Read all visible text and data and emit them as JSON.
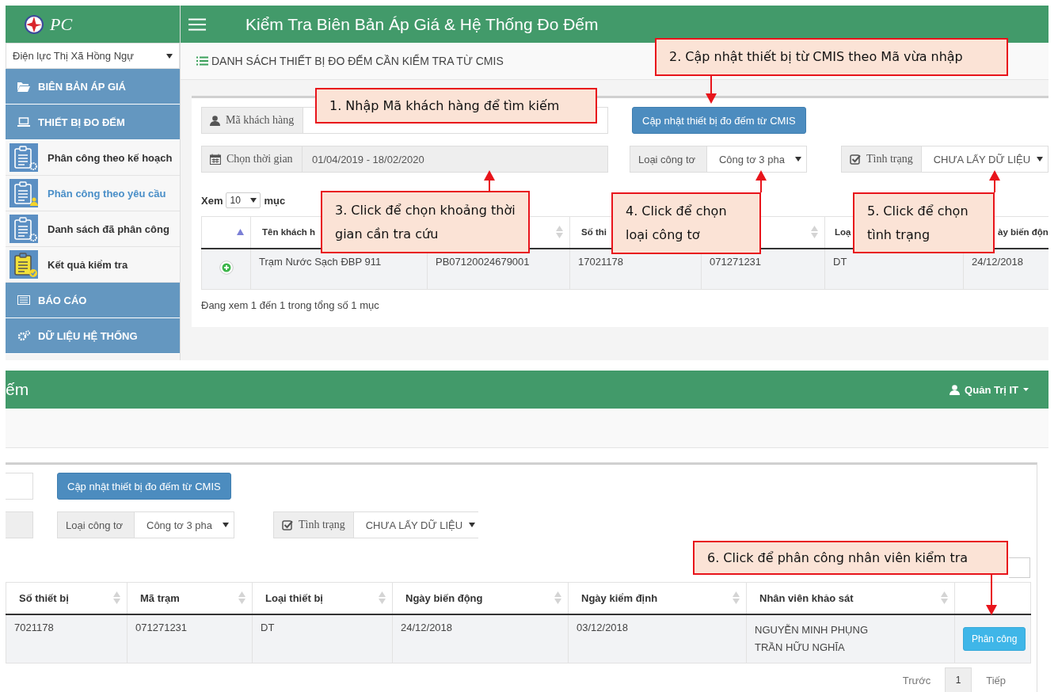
{
  "top_view": {
    "logo": {
      "text": "PC"
    },
    "unit_select": {
      "value": "Điện lực Thị Xã Hồng Ngự"
    },
    "header": {
      "title": "Kiểm Tra Biên Bản Áp Giá & Hệ Thống Đo Đếm"
    },
    "sidebar": {
      "items": [
        {
          "label": "BIÊN BẢN ÁP GIÁ"
        },
        {
          "label": "THIẾT BỊ ĐO ĐẾM",
          "children": [
            {
              "label": "Phân công theo kế hoạch",
              "selected": false
            },
            {
              "label": "Phân công theo yêu cầu",
              "selected": true
            },
            {
              "label": "Danh sách đã phân công",
              "selected": false
            },
            {
              "label": "Kết quả kiểm tra",
              "selected": false
            }
          ]
        },
        {
          "label": "BÁO CÁO"
        },
        {
          "label": "DỮ LIỆU HỆ THỐNG"
        }
      ]
    },
    "page_heading": "DANH SÁCH THIẾT BỊ ĐO ĐẾM CẦN KIỂM TRA TỪ CMIS",
    "customer_code": {
      "label": "Mã khách hàng"
    },
    "update_button": "Cập nhật thiết bị đo đếm từ CMIS",
    "time_range": {
      "label": "Chọn thời gian",
      "value": "01/04/2019 - 18/02/2020"
    },
    "meter_type": {
      "label": "Loại công tơ",
      "value": "Công tơ 3 pha"
    },
    "status": {
      "label": "Tình trạng",
      "value": "CHƯA LẤY DỮ LIỆU"
    },
    "page_size": {
      "prefix": "Xem",
      "value": "10",
      "suffix": "mục"
    },
    "table": {
      "columns": [
        {
          "kind": "expander",
          "sorted": true
        },
        {
          "kind": "text",
          "label": "Tên khách h"
        },
        {
          "kind": "text",
          "sortable": true
        },
        {
          "kind": "text",
          "label": "Số thi"
        },
        {
          "kind": "text",
          "sortable": true
        },
        {
          "kind": "text",
          "label": "Loạ"
        },
        {
          "kind": "text",
          "label": "ày biến độn"
        }
      ],
      "rows": [
        {
          "cells": [
            "",
            "Trạm Nước Sạch ĐBP 911",
            "PB07120024679001",
            "17021178",
            "071271231",
            "DT",
            "24/12/2018"
          ]
        }
      ]
    },
    "info": "Đang xem 1 đến 1 trong tổng số 1 mục"
  },
  "bottom_view": {
    "header": {
      "title": "ếm",
      "user": "Quản Trị IT"
    },
    "update_button": "Cập nhật thiết bị đo đếm từ CMIS",
    "meter_type": {
      "label": "Loại công tơ",
      "value": "Công tơ 3 pha"
    },
    "status": {
      "label": "Tình trạng",
      "value": "CHƯA LẤY DỮ LIỆU"
    },
    "table": {
      "columns": [
        {
          "kind": "text",
          "label": "Số thiết bị",
          "sortable": true
        },
        {
          "kind": "text",
          "label": "Mã trạm",
          "sortable": true
        },
        {
          "kind": "text",
          "label": "Loại thiết bị",
          "sortable": true
        },
        {
          "kind": "text",
          "label": "Ngày biến động",
          "sortable": true
        },
        {
          "kind": "text",
          "label": "Ngày kiểm định",
          "sortable": true
        },
        {
          "kind": "text",
          "label": "Nhân viên khảo sát",
          "sortable": true
        },
        {
          "kind": "action"
        }
      ],
      "rows": [
        {
          "cells": [
            "7021178",
            "071271231",
            "DT",
            "24/12/2018",
            "03/12/2018",
            [
              "NGUYỄN MINH PHỤNG",
              "TRẦN HỮU NGHĨA"
            ],
            "Phân công"
          ]
        }
      ]
    },
    "pagination": {
      "previous": "Trước",
      "pages": [
        {
          "label": "1",
          "selected": true
        }
      ],
      "next": "Tiếp"
    }
  },
  "callouts": [
    {
      "kind": "plain",
      "text": "1. Nhập Mã khách hàng để tìm kiếm"
    },
    {
      "kind": "down",
      "text": "2. Cập nhật thiết bị từ CMIS theo Mã vừa nhập"
    },
    {
      "kind": "up",
      "text": "3. Click để chọn khoảng thời gian cần tra cứu"
    },
    {
      "kind": "up",
      "text": "4. Click để chọn loại công tơ"
    },
    {
      "kind": "up",
      "text": "5. Click để chọn tình trạng"
    },
    {
      "kind": "down",
      "text": "6. Click để phân công nhân viên kiểm tra"
    }
  ]
}
